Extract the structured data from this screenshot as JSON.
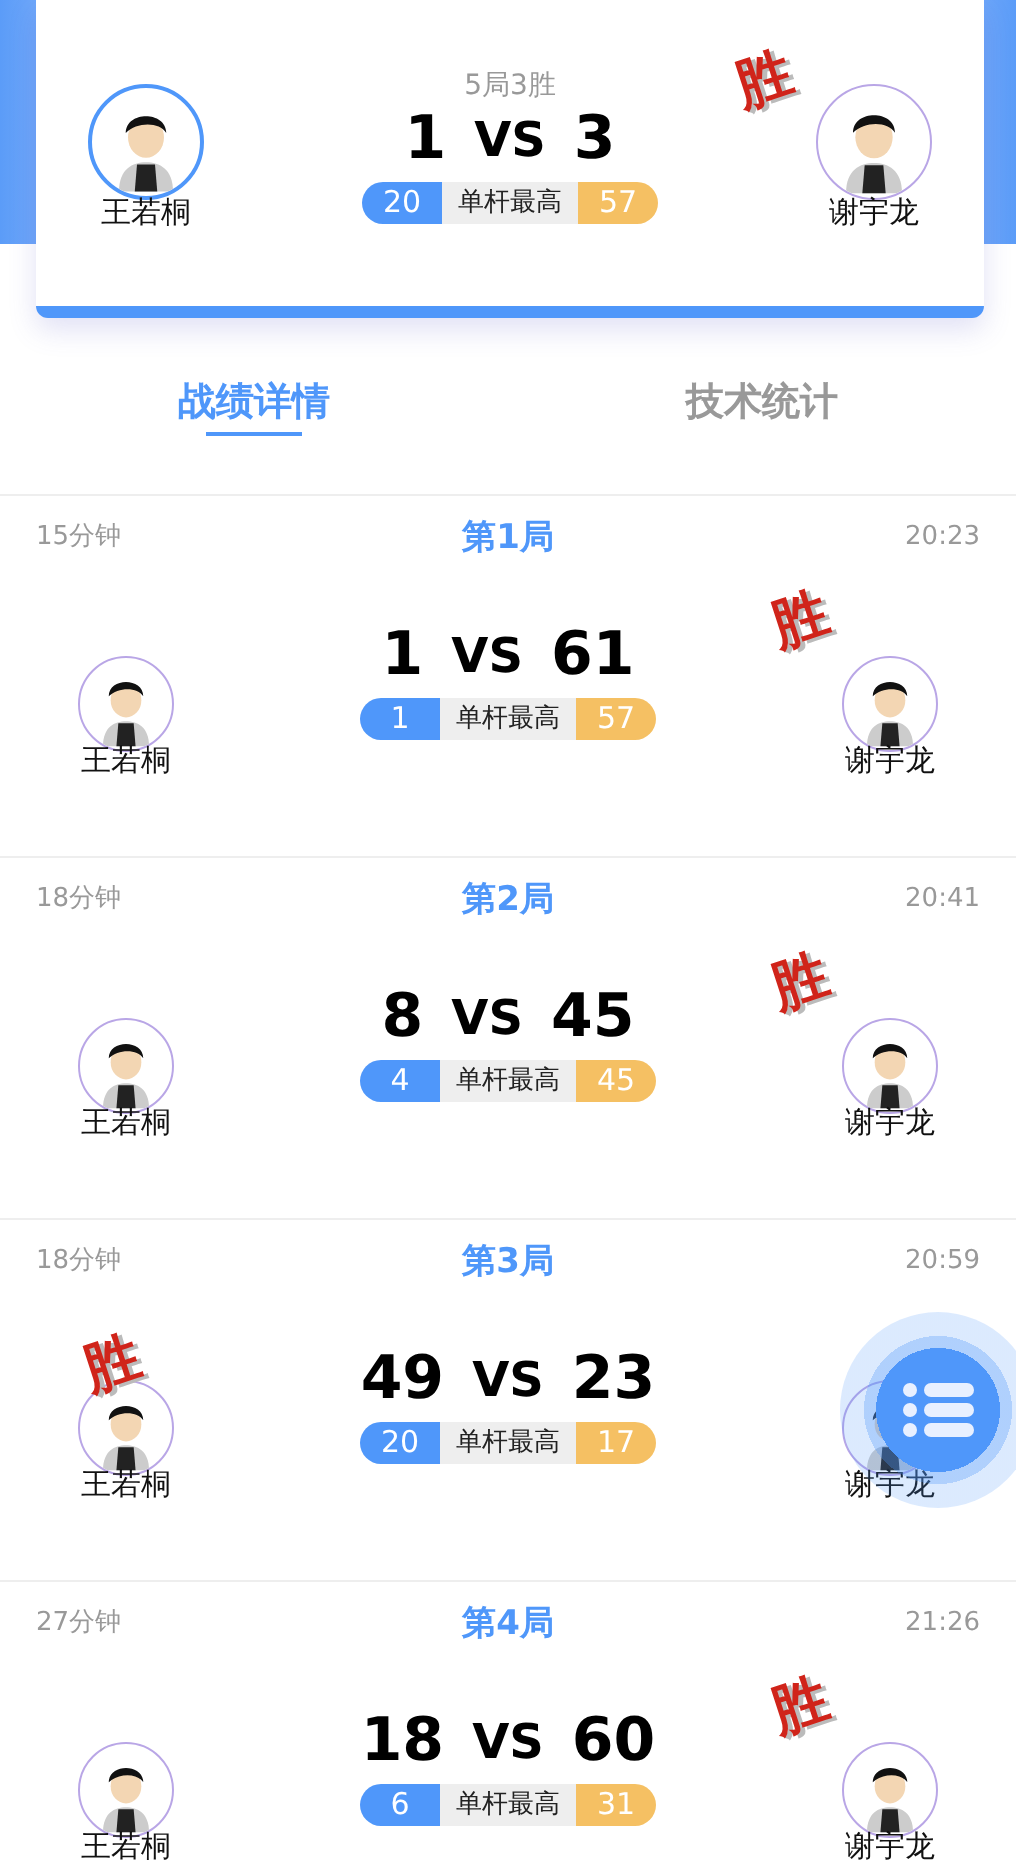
{
  "match": {
    "format": "5局3胜",
    "left": {
      "name": "王若桐",
      "score": "1",
      "best_break": "20",
      "winner": false
    },
    "right": {
      "name": "谢宇龙",
      "score": "3",
      "best_break": "57",
      "winner": true
    },
    "vs": "VS",
    "break_label": "单杆最高",
    "win_mark": "胜"
  },
  "tabs": [
    {
      "label": "战绩详情",
      "selected": true
    },
    {
      "label": "技术统计",
      "selected": false
    }
  ],
  "games": [
    {
      "duration": "15分钟",
      "title": "第1局",
      "time": "20:23",
      "left": {
        "name": "王若桐",
        "score": "1",
        "best_break": "1",
        "winner": false
      },
      "right": {
        "name": "谢宇龙",
        "score": "61",
        "best_break": "57",
        "winner": true
      },
      "vs": "VS",
      "break_label": "单杆最高",
      "win_mark": "胜"
    },
    {
      "duration": "18分钟",
      "title": "第2局",
      "time": "20:41",
      "left": {
        "name": "王若桐",
        "score": "8",
        "best_break": "4",
        "winner": false
      },
      "right": {
        "name": "谢宇龙",
        "score": "45",
        "best_break": "45",
        "winner": true
      },
      "vs": "VS",
      "break_label": "单杆最高",
      "win_mark": "胜"
    },
    {
      "duration": "18分钟",
      "title": "第3局",
      "time": "20:59",
      "left": {
        "name": "王若桐",
        "score": "49",
        "best_break": "20",
        "winner": true
      },
      "right": {
        "name": "谢宇龙",
        "score": "23",
        "best_break": "17",
        "winner": false
      },
      "vs": "VS",
      "break_label": "单杆最高",
      "win_mark": "胜"
    },
    {
      "duration": "27分钟",
      "title": "第4局",
      "time": "21:26",
      "left": {
        "name": "王若桐",
        "score": "18",
        "best_break": "6",
        "winner": false
      },
      "right": {
        "name": "谢宇龙",
        "score": "60",
        "best_break": "31",
        "winner": true
      },
      "vs": "VS",
      "break_label": "单杆最高",
      "win_mark": "胜"
    }
  ]
}
